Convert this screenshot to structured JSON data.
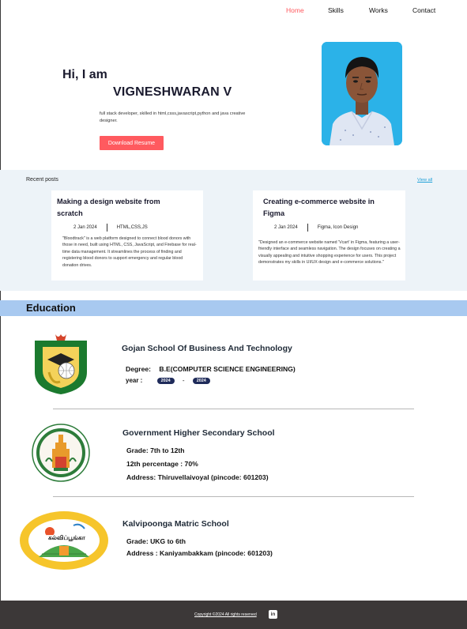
{
  "nav": {
    "home": "Home",
    "skills": "Skills",
    "works": "Works",
    "contact": "Contact"
  },
  "hero": {
    "greeting": "Hi, I am",
    "name": "VIGNESHWARAN V",
    "description": "full stack developer, skilled in html,csss,javascript,python and java creative designer.",
    "resume_button": "Download Resume"
  },
  "recent_posts": {
    "title": "Recent posts",
    "view_all": "View all",
    "posts": [
      {
        "title_line1": "Making a design website  from",
        "title_line2": "scratch",
        "date": "2  Jan 2024",
        "tags": "HTML,CSS,JS",
        "body": "\"Bloodtrack\" is a web platform designed to connect blood donors with those in need, built using HTML, CSS, JavaScript, and Firebase for real-time data management. It streamlines the process of finding and registering blood donors to support emergency and regular blood donation drives."
      },
      {
        "title_line1": "Creating e-commerce website in",
        "title_line2": "Figma",
        "date": "2  Jan 2024",
        "tags": "Figma, Icon Design",
        "body": "\"Designed an e-commerce website named 'Vcart' in Figma, featuring a user-friendly interface and seamless navigation. The design focuses on creating a visually appealing and intuitive shopping experience for users. This project demonstrates my skills in UI/UX design and e-commerce solutions.\""
      }
    ]
  },
  "education": {
    "title": "Education",
    "schools": [
      {
        "name": "Gojan School Of Business And Technology",
        "degree_label": "Degree:",
        "degree": "B.E(COMPUTER SCIENCE ENGINEERING)",
        "year_label": "year :",
        "year_from": "2024",
        "year_sep": "-",
        "year_to": "2024",
        "logo_text": "GOJAN SCHOOL OF BUSINESS AND TECHNOLOGY"
      },
      {
        "name": "Government Higher Secondary School",
        "grade": "Grade:  7th  to  12th",
        "percentage": "12th percentage :  70%",
        "address": "Address: Thiruvellaivoyal (pincode: 601203)",
        "logo_top": "GOVERNMENT OF TAMIL NADU",
        "logo_bottom": "TRUTH ALONE TRIUMPHS"
      },
      {
        "name": "Kalvipoonga Matric School",
        "grade": "Grade:  UKG  to  6th",
        "address": "Address :  Kaniyambakkam (pincode: 601203)",
        "logo_top": "KALVIPOONGA MATRICULATION SCHOOL",
        "logo_center": "கல்விப்பூங்கா"
      }
    ]
  },
  "footer": {
    "copyright": "Copyright ©2024 All rights reserved",
    "linkedin": "in"
  },
  "colors": {
    "accent": "#ff5a5f",
    "posts_band": "#edf3f8",
    "education_bar": "#a8c9f0",
    "footer": "#3c3838",
    "pill": "#1f2b5a",
    "link": "#20a0d8"
  }
}
